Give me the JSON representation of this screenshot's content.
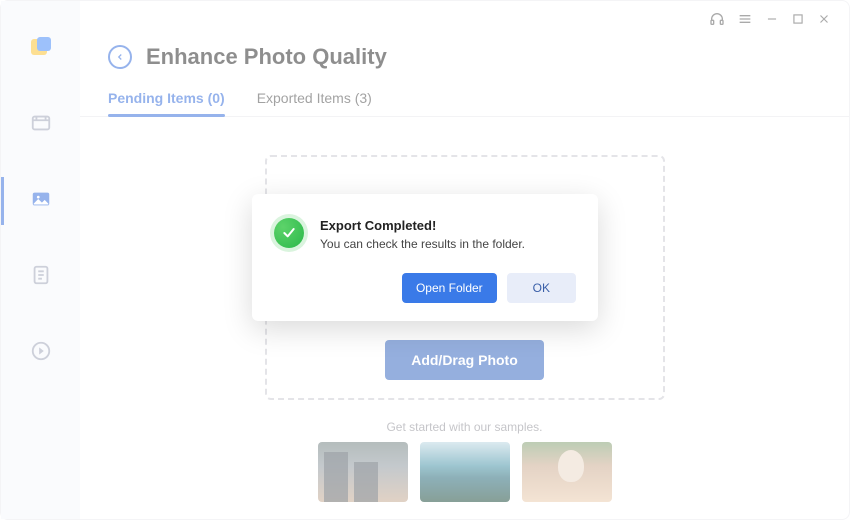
{
  "header": {
    "title": "Enhance Photo Quality"
  },
  "tabs": [
    {
      "label": "Pending Items (0)",
      "active": true
    },
    {
      "label": "Exported Items (3)",
      "active": false
    }
  ],
  "dropzone": {
    "button_label": "Add/Drag Photo"
  },
  "samples": {
    "label": "Get started with our samples."
  },
  "modal": {
    "title": "Export Completed!",
    "message": "You can check the results in the folder.",
    "primary_label": "Open Folder",
    "secondary_label": "OK"
  },
  "icons": {
    "back": "back-arrow",
    "help": "headphones",
    "menu": "menu-lines",
    "minimize": "minimize",
    "maximize": "maximize",
    "close": "close"
  }
}
